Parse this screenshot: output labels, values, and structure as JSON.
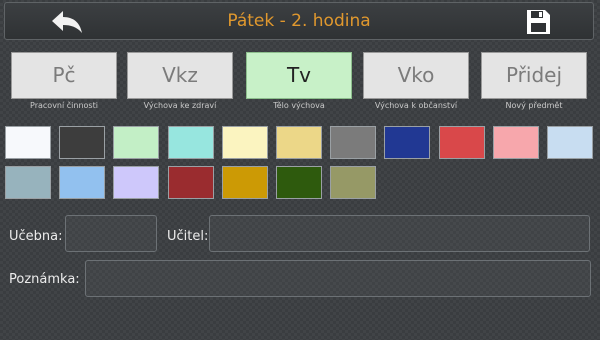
{
  "header": {
    "title": "Pátek - 2. hodina",
    "back_icon": "back-arrow-icon",
    "save_icon": "save-disk-icon"
  },
  "subjects": [
    {
      "abbr": "Pč",
      "name": "Pracovní činnosti",
      "selected": false
    },
    {
      "abbr": "Vkz",
      "name": "Výchova ke zdraví",
      "selected": false
    },
    {
      "abbr": "Tv",
      "name": "Tělo výchova",
      "selected": true
    },
    {
      "abbr": "Vko",
      "name": "Výchova k občanství",
      "selected": false
    },
    {
      "abbr": "Přidej",
      "name": "Nový předmět",
      "selected": false
    }
  ],
  "colors": [
    "#f7f9fc",
    "#3d3d3d",
    "#c3efc6",
    "#97e6df",
    "#fbf4c0",
    "#ecd788",
    "#7b7b7b",
    "#213893",
    "#d9484a",
    "#f7a7ac",
    "#c8ddf1",
    "#97b3bd",
    "#92c1ef",
    "#cec8fb",
    "#9a2c2f",
    "#cc9a05",
    "#2e5a0d",
    "#969966"
  ],
  "form": {
    "ucebna_label": "Učebna:",
    "ucebna_value": "",
    "ucitel_label": "Učitel:",
    "ucitel_value": "",
    "poznamka_label": "Poznámka:",
    "poznamka_value": ""
  }
}
